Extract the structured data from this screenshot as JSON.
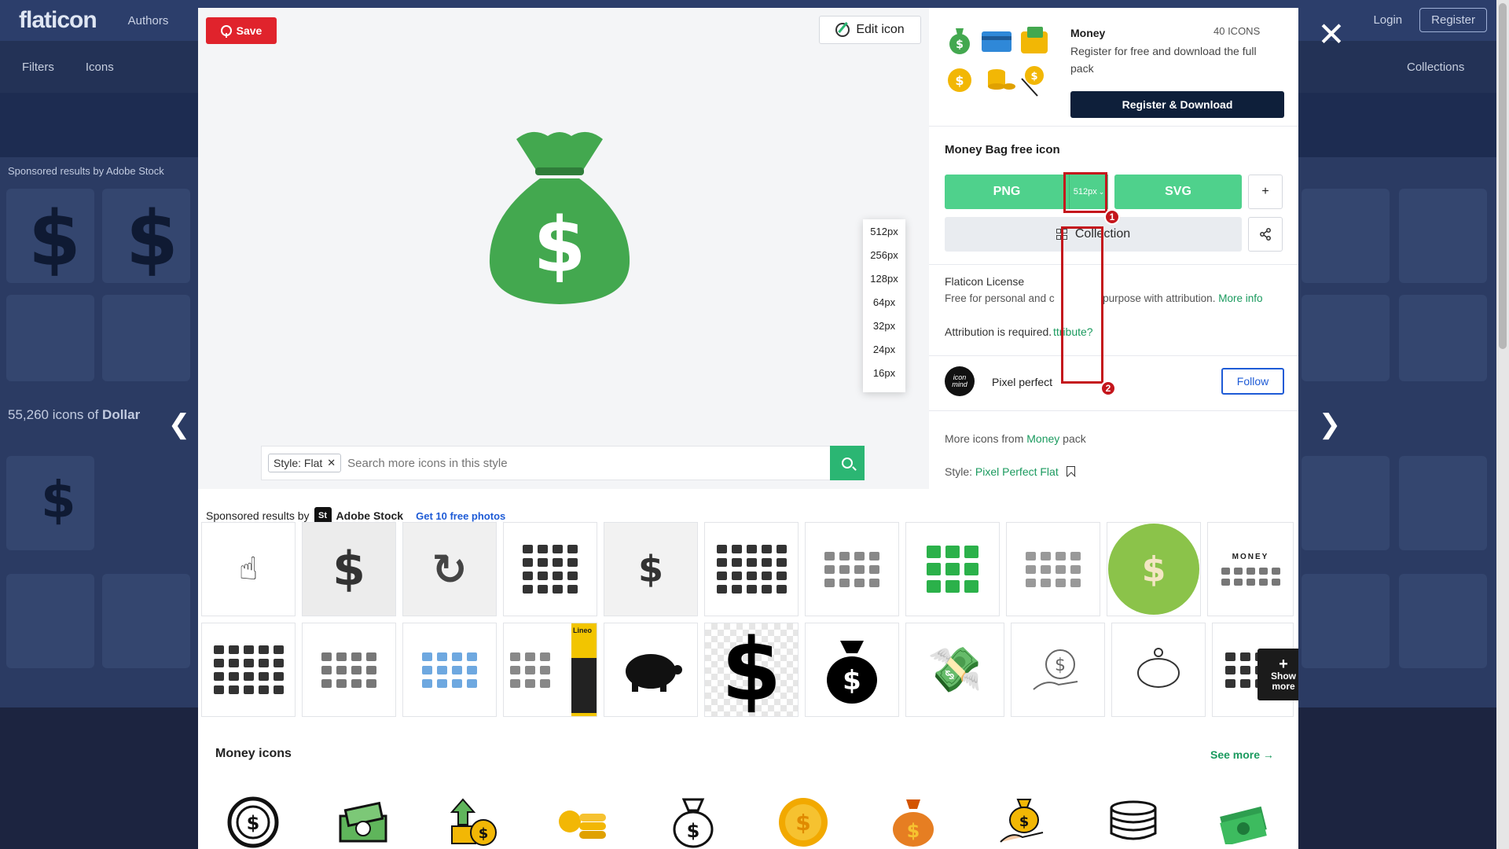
{
  "background": {
    "logo": "flaticon",
    "nav": [
      "Authors"
    ],
    "right_links": [
      "Login",
      "Register"
    ],
    "filters_label": "Filters",
    "icons_dropdown": "Icons",
    "collections_label": "Collections",
    "sponsored_text": "Sponsored results by",
    "adobe_stock": "Adobe Stock",
    "results_count": "55,260 icons of",
    "results_term": "Dollar"
  },
  "modal": {
    "save_label": "Save",
    "edit_label": "Edit icon",
    "style_chip": "Style: Flat",
    "style_search_placeholder": "Search more icons in this style",
    "pack": {
      "title": "Money",
      "count": "40 ICONS",
      "description": "Register for free and download the full pack",
      "register_label": "Register & Download"
    },
    "icon_name": "Money Bag free icon",
    "png_label": "PNG",
    "size_selected": "512px",
    "svg_label": "SVG",
    "plus_label": "+",
    "collection_label": "Collection",
    "license_title": "Flaticon License",
    "license_text_a": "Free for personal and c",
    "license_text_b": "purpose with attribution.",
    "more_info": "More info",
    "attribution_text": "Attribution is required.",
    "attribution_link": "ttribute?",
    "author_logo_text": "icon mind",
    "author_name": "Pixel perfect",
    "follow_label": "Follow",
    "more_from_prefix": "More icons from",
    "more_from_pack": "Money",
    "more_from_suffix": "pack",
    "style_prefix": "Style:",
    "style_name": "Pixel Perfect Flat",
    "sizes": [
      "512px",
      "256px",
      "128px",
      "64px",
      "32px",
      "24px",
      "16px"
    ],
    "badges": [
      "1",
      "2"
    ],
    "sponsored": {
      "prefix": "Sponsored results by",
      "brand_logo": "St",
      "brand": "Adobe Stock",
      "link": "Get 10 free photos",
      "thumb_texts": [
        "MONEY",
        "Lineo"
      ],
      "show_more": [
        "+",
        "Show",
        "more"
      ]
    },
    "money_icons_title": "Money icons",
    "see_more_label": "See more →"
  },
  "colors": {
    "accent_green": "#4fd18c",
    "brand_green": "#1a9a5e",
    "icon_green": "#43a84f",
    "save_red": "#e0232c",
    "highlight_red": "#c4161c",
    "navy": "#0e1f3a"
  },
  "icons": [
    "close-icon",
    "prev-arrow-icon",
    "next-arrow-icon",
    "pinterest-icon",
    "edit-icon",
    "money-bag-icon",
    "search-icon",
    "share-icon",
    "collection-icon",
    "bookmark-icon",
    "chevron-down-icon"
  ]
}
